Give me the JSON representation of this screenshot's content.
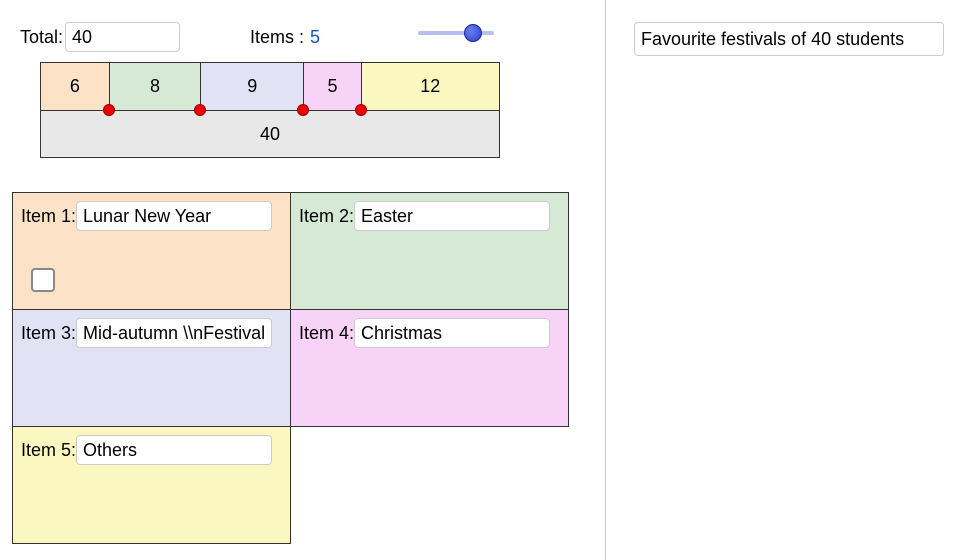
{
  "top": {
    "total_label": "Total:",
    "total_value": "40",
    "items_label": "Items :",
    "items_value": "5",
    "slider_min": 1,
    "slider_max": 6,
    "slider_value": 5
  },
  "bar": {
    "segments": [
      {
        "value": "6",
        "color": "c1",
        "width_pct": 15.0
      },
      {
        "value": "8",
        "color": "c2",
        "width_pct": 20.0
      },
      {
        "value": "9",
        "color": "c3",
        "width_pct": 22.5
      },
      {
        "value": "5",
        "color": "c4",
        "width_pct": 12.5
      },
      {
        "value": "12",
        "color": "c5",
        "width_pct": 30.0
      }
    ],
    "total_label": "40"
  },
  "items": [
    {
      "label": "Item 1:",
      "value": "Lunar New Year",
      "color": "c1",
      "checkbox": true
    },
    {
      "label": "Item 2:",
      "value": "Easter",
      "color": "c2"
    },
    {
      "label": "Item 3:",
      "value": "Mid-autumn \\\\nFestival",
      "color": "c3"
    },
    {
      "label": "Item 4:",
      "value": "Christmas",
      "color": "c4"
    },
    {
      "label": "Item 5:",
      "value": "Others",
      "color": "c5"
    }
  ],
  "title": {
    "value": "Favourite festivals of 40 students"
  }
}
